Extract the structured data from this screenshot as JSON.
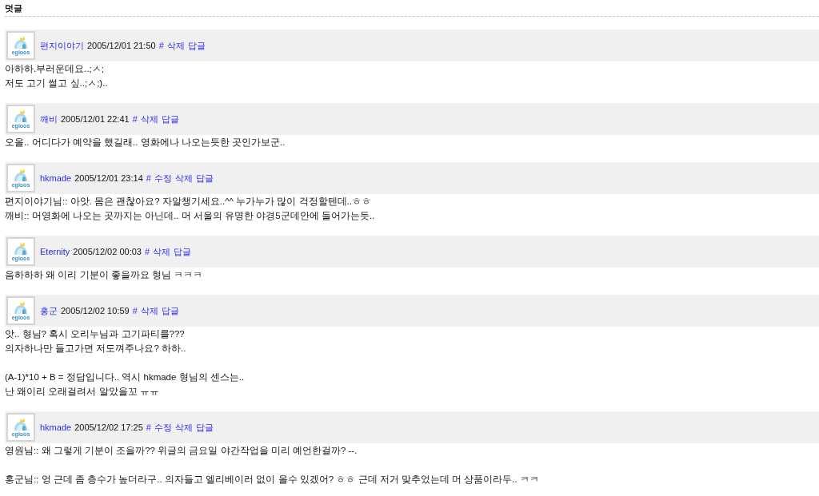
{
  "section": {
    "title": "덧글"
  },
  "comments": [
    {
      "avatar_text": "egloos",
      "author": "편지이야기",
      "date": "2005/12/01 21:50",
      "actions": [
        "#",
        "삭제",
        "답글"
      ],
      "paragraphs": [
        [
          "아하하.부러운데요..;ㅅ;",
          "저도 고기 썰고 싶..;ㅅ;).."
        ]
      ]
    },
    {
      "avatar_text": "egloos",
      "author": "깨비",
      "date": "2005/12/01 22:41",
      "actions": [
        "#",
        "삭제",
        "답글"
      ],
      "paragraphs": [
        [
          "오올.. 어디다가 예약을 했길래.. 영화에나 나오는듯한 곳인가보군.."
        ]
      ]
    },
    {
      "avatar_text": "egloos",
      "author": "hkmade",
      "date": "2005/12/01 23:14",
      "actions": [
        "#",
        "수정",
        "삭제",
        "답글"
      ],
      "paragraphs": [
        [
          "편지이야기님:: 아앗. 몸은 괜찮아요? 자알챙기세요..^^ 누가누가 많이 걱정할텐데..ㅎㅎ",
          "깨비:: 머영화에 나오는 곳까지는 아닌데.. 머 서울의 유명한 야경5군데안에 들어가는듯.."
        ]
      ]
    },
    {
      "avatar_text": "egloos",
      "author": "Eternity",
      "date": "2005/12/02 00:03",
      "actions": [
        "#",
        "삭제",
        "답글"
      ],
      "paragraphs": [
        [
          "음하하하 왜 이리 기분이 좋을까요 형님 ㅋㅋㅋ"
        ]
      ]
    },
    {
      "avatar_text": "egloos",
      "author": "홍군",
      "date": "2005/12/02 10:59",
      "actions": [
        "#",
        "삭제",
        "답글"
      ],
      "paragraphs": [
        [
          "앗.. 형님? 혹시 오리누님과 고기파티를???",
          "의자하나만 들고가면 저도껴주나요? 하하.."
        ],
        [
          "(A-1)*10 + B = 정답입니다.. 역시 hkmade 형님의 센스는..",
          "난 왜이리 오래걸려서 알았을꼬 ㅠㅠ"
        ]
      ]
    },
    {
      "avatar_text": "egloos",
      "author": "hkmade",
      "date": "2005/12/02 17:25",
      "actions": [
        "#",
        "수정",
        "삭제",
        "답글"
      ],
      "paragraphs": [
        [
          "영원님:: 왜 그렇게 기분이 조을까?? 위글의 금요일 야간작업을 미리 예언한걸까? --."
        ],
        [
          "홍군님:: 엉 근데 좀 층수가 높더라구.. 의자들고 엘리베이러 없이 올수 있겠어? ㅎㅎ 근데 저거 맞추었는데 머 상품이라두.. ㅋㅋ"
        ]
      ]
    }
  ]
}
